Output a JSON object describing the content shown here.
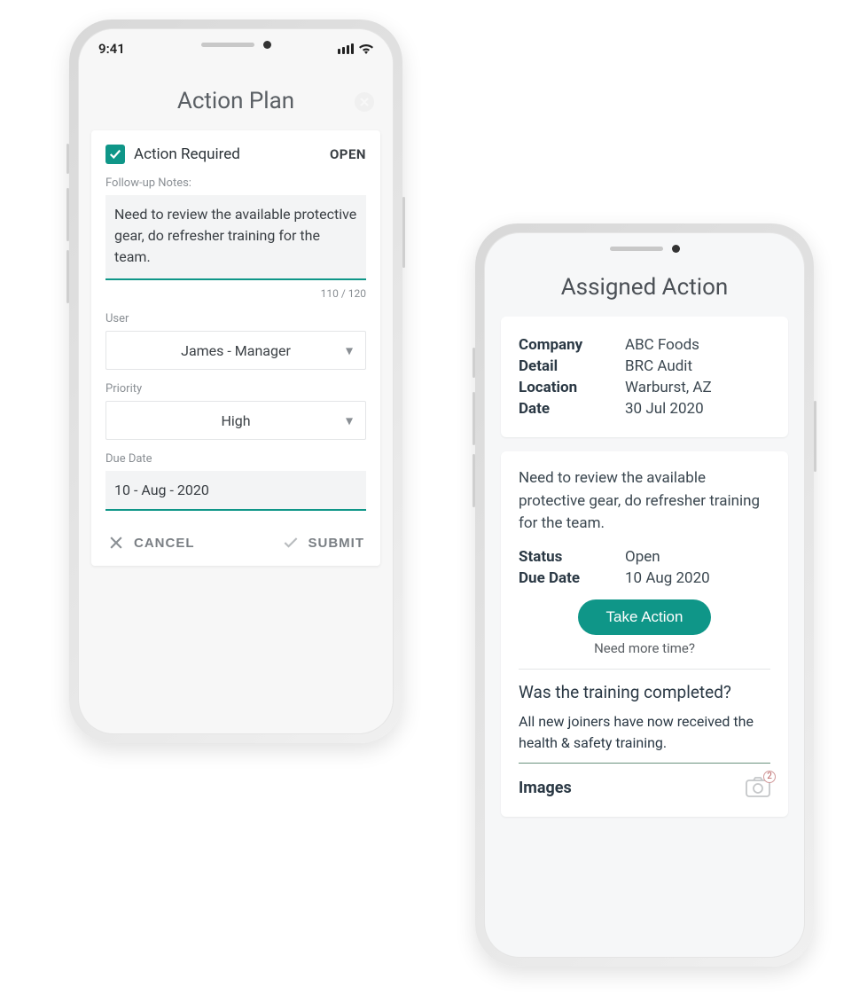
{
  "phone1": {
    "status": {
      "time": "9:41"
    },
    "header": {
      "title": "Action Plan"
    },
    "action_required": {
      "label": "Action Required",
      "status": "OPEN"
    },
    "notes": {
      "label": "Follow-up Notes:",
      "value": "Need to review the available protective gear, do refresher training for the team.",
      "counter": "110 / 120"
    },
    "user": {
      "label": "User",
      "value": "James  - Manager"
    },
    "priority": {
      "label": "Priority",
      "value": "High"
    },
    "due": {
      "label": "Due Date",
      "value": "10 - Aug - 2020"
    },
    "buttons": {
      "cancel": "CANCEL",
      "submit": "SUBMIT"
    }
  },
  "phone2": {
    "header": {
      "title": "Assigned Action"
    },
    "info": {
      "company_k": "Company",
      "company_v": "ABC Foods",
      "detail_k": "Detail",
      "detail_v": "BRC Audit",
      "location_k": "Location",
      "location_v": "Warburst, AZ",
      "date_k": "Date",
      "date_v": "30 Jul 2020"
    },
    "detail": {
      "text": "Need to review the available protective gear, do refresher training for the team.",
      "status_k": "Status",
      "status_v": "Open",
      "due_k": "Due Date",
      "due_v": "10 Aug 2020",
      "cta": "Take Action",
      "more": "Need more time?"
    },
    "question": {
      "q": "Was the training completed?",
      "a": "All new joiners have now received the health & safety training."
    },
    "images": {
      "label": "Images",
      "badge": "2"
    }
  }
}
